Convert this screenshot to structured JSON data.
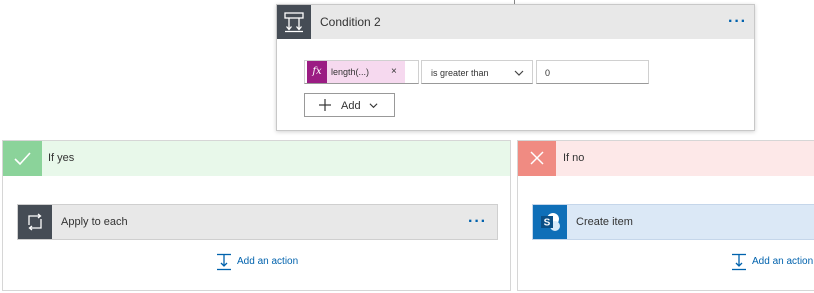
{
  "condition": {
    "title": "Condition 2",
    "menu_label": "···",
    "token": {
      "icon": "fx",
      "label": "length(...)",
      "remove": "×"
    },
    "operator": "is greater than",
    "value": "0",
    "add_button_label": "Add"
  },
  "yes_branch": {
    "title": "If yes",
    "action": {
      "label": "Apply to each",
      "menu_label": "···"
    },
    "add_action_label": "Add an action"
  },
  "no_branch": {
    "title": "If no",
    "action": {
      "label": "Create item"
    },
    "add_action_label": "Add an action"
  },
  "colors": {
    "dark_icon_bg": "#454c55",
    "accent_blue": "#0062ad",
    "yes_green": "#8bd39a",
    "yes_bg": "#e8f8ea",
    "no_red": "#f08b82",
    "no_bg": "#fde8e8",
    "token_purple": "#9b1c83",
    "token_bg": "#f6d9ef",
    "sharepoint_blue": "#0f6fb8"
  },
  "icons": {
    "condition": "condition-icon",
    "yes": "checkmark-icon",
    "no": "x-icon",
    "loop": "loop-icon",
    "sharepoint": "sharepoint-icon",
    "add_action": "add-action-icon",
    "chevron": "chevron-down-icon",
    "plus": "plus-icon"
  }
}
